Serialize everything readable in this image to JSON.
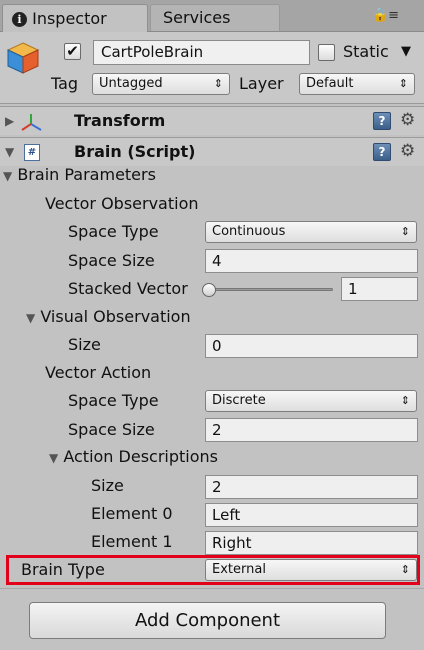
{
  "tabs": [
    {
      "label": "Inspector",
      "active": true
    },
    {
      "label": "Services",
      "active": false
    }
  ],
  "gameobject": {
    "enabled": true,
    "name": "CartPoleBrain",
    "static_label": "Static",
    "static_checked": false,
    "tag_label": "Tag",
    "tag_value": "Untagged",
    "layer_label": "Layer",
    "layer_value": "Default"
  },
  "components": {
    "transform": {
      "title": "Transform"
    },
    "brain": {
      "title": "Brain (Script)"
    }
  },
  "brain_parameters": {
    "title": "Brain Parameters",
    "vector_observation": {
      "title": "Vector Observation",
      "space_type_label": "Space Type",
      "space_type_value": "Continuous",
      "space_size_label": "Space Size",
      "space_size_value": "4",
      "stacked_vectors_label": "Stacked Vector",
      "stacked_vectors_value": "1"
    },
    "visual_observation": {
      "title": "Visual Observation",
      "size_label": "Size",
      "size_value": "0"
    },
    "vector_action": {
      "title": "Vector Action",
      "space_type_label": "Space Type",
      "space_type_value": "Discrete",
      "space_size_label": "Space Size",
      "space_size_value": "2",
      "action_descriptions": {
        "title": "Action Descriptions",
        "size_label": "Size",
        "size_value": "2",
        "elements": [
          {
            "label": "Element 0",
            "value": "Left"
          },
          {
            "label": "Element 1",
            "value": "Right"
          }
        ]
      }
    }
  },
  "brain_type": {
    "label": "Brain Type",
    "value": "External",
    "highlight_color": "#e3001b"
  },
  "add_component_label": "Add Component"
}
